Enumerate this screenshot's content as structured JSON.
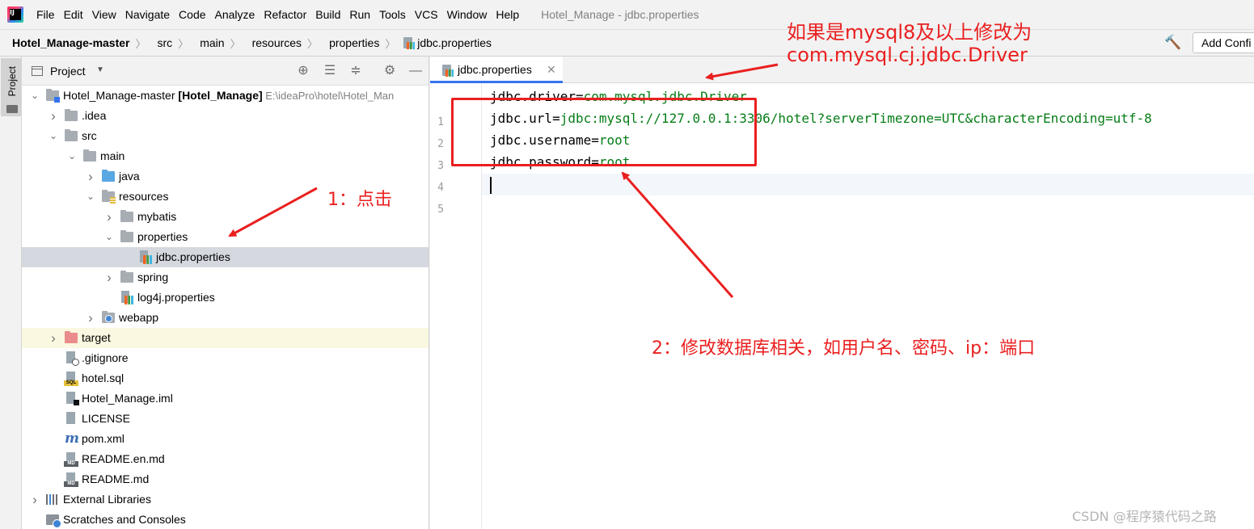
{
  "menubar": {
    "items": [
      "File",
      "Edit",
      "View",
      "Navigate",
      "Code",
      "Analyze",
      "Refactor",
      "Build",
      "Run",
      "Tools",
      "VCS",
      "Window",
      "Help"
    ],
    "window_title": "Hotel_Manage - jdbc.properties"
  },
  "navbar": {
    "breadcrumb": [
      "Hotel_Manage-master",
      "src",
      "main",
      "resources",
      "properties",
      "jdbc.properties"
    ],
    "add_config_label": "Add Confi"
  },
  "tool_strip": {
    "project_tab": "Project"
  },
  "project_panel": {
    "title": "Project",
    "tree": [
      {
        "label": "Hotel_Manage-master",
        "module": "[Hotel_Manage]",
        "hint": "E:\\ideaPro\\hotel\\Hotel_Man",
        "icon": "module-folder-icon",
        "depth": 0,
        "chevron": "open"
      },
      {
        "label": ".idea",
        "icon": "folder-icon",
        "depth": 1,
        "chevron": "closed"
      },
      {
        "label": "src",
        "icon": "folder-icon",
        "depth": 1,
        "chevron": "open"
      },
      {
        "label": "main",
        "icon": "folder-icon",
        "depth": 2,
        "chevron": "open"
      },
      {
        "label": "java",
        "icon": "source-folder-icon",
        "depth": 3,
        "chevron": "closed"
      },
      {
        "label": "resources",
        "icon": "resources-folder-icon",
        "depth": 3,
        "chevron": "open"
      },
      {
        "label": "mybatis",
        "icon": "folder-icon",
        "depth": 4,
        "chevron": "closed"
      },
      {
        "label": "properties",
        "icon": "folder-icon",
        "depth": 4,
        "chevron": "open"
      },
      {
        "label": "jdbc.properties",
        "icon": "properties-file-icon",
        "depth": 5,
        "chevron": "none",
        "selected": true
      },
      {
        "label": "spring",
        "icon": "folder-icon",
        "depth": 4,
        "chevron": "closed"
      },
      {
        "label": "log4j.properties",
        "icon": "properties-file-icon",
        "depth": 4,
        "chevron": "none"
      },
      {
        "label": "webapp",
        "icon": "web-folder-icon",
        "depth": 3,
        "chevron": "closed"
      },
      {
        "label": "target",
        "icon": "excluded-folder-icon",
        "depth": 1,
        "chevron": "closed",
        "excluded": true
      },
      {
        "label": ".gitignore",
        "icon": "gitignore-file-icon",
        "depth": 1,
        "chevron": "none"
      },
      {
        "label": "hotel.sql",
        "icon": "sql-file-icon",
        "depth": 1,
        "chevron": "none"
      },
      {
        "label": "Hotel_Manage.iml",
        "icon": "iml-file-icon",
        "depth": 1,
        "chevron": "none"
      },
      {
        "label": "LICENSE",
        "icon": "text-file-icon",
        "depth": 1,
        "chevron": "none"
      },
      {
        "label": "pom.xml",
        "icon": "maven-file-icon",
        "depth": 1,
        "chevron": "none"
      },
      {
        "label": "README.en.md",
        "icon": "markdown-file-icon",
        "depth": 1,
        "chevron": "none"
      },
      {
        "label": "README.md",
        "icon": "markdown-file-icon",
        "depth": 1,
        "chevron": "none"
      },
      {
        "label": "External Libraries",
        "icon": "libraries-icon",
        "depth": 0,
        "chevron": "closed"
      },
      {
        "label": "Scratches and Consoles",
        "icon": "scratches-icon",
        "depth": 0,
        "chevron": "none"
      }
    ]
  },
  "editor": {
    "tab_label": "jdbc.properties",
    "lines": [
      {
        "num": "1",
        "key": "jdbc.driver",
        "value": "com.mysql.jdbc.Driver"
      },
      {
        "num": "2",
        "key": "jdbc.url",
        "value": "jdbc:mysql://127.0.0.1:3306/hotel?serverTimezone=UTC&characterEncoding=utf-8"
      },
      {
        "num": "3",
        "key": "jdbc.username",
        "value": "root"
      },
      {
        "num": "4",
        "key": "jdbc.password",
        "value": "root"
      },
      {
        "num": "5",
        "key": "",
        "value": ""
      }
    ]
  },
  "annotations": {
    "top_note_line1": "如果是mysql8及以上修改为",
    "top_note_line2": "com.mysql.cj.jdbc.Driver",
    "step1": "1：点击",
    "step2": "2：修改数据库相关，如用户名、密码、ip：端口",
    "color": "#ea1f1f"
  },
  "watermark": "CSDN @程序猿代码之路"
}
